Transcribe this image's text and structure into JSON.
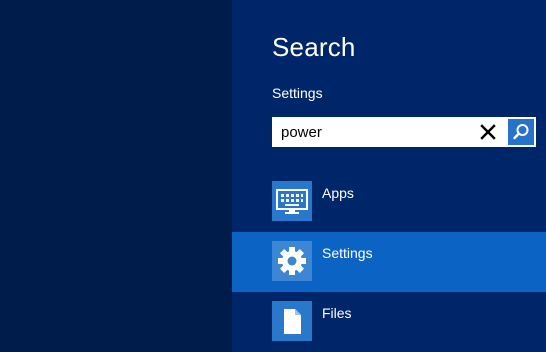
{
  "search_pane": {
    "title": "Search",
    "scope": "Settings",
    "query": "power",
    "results": [
      {
        "label": "Apps",
        "icon": "keyboard-icon",
        "selected": false
      },
      {
        "label": "Settings",
        "icon": "gear-icon",
        "selected": true
      },
      {
        "label": "Files",
        "icon": "document-icon",
        "selected": false
      }
    ]
  },
  "colors": {
    "background": "#001c4a",
    "pane": "#00266a",
    "selected": "#0b64c4",
    "tile": "#2a78cc",
    "accent": "#2673c9"
  }
}
